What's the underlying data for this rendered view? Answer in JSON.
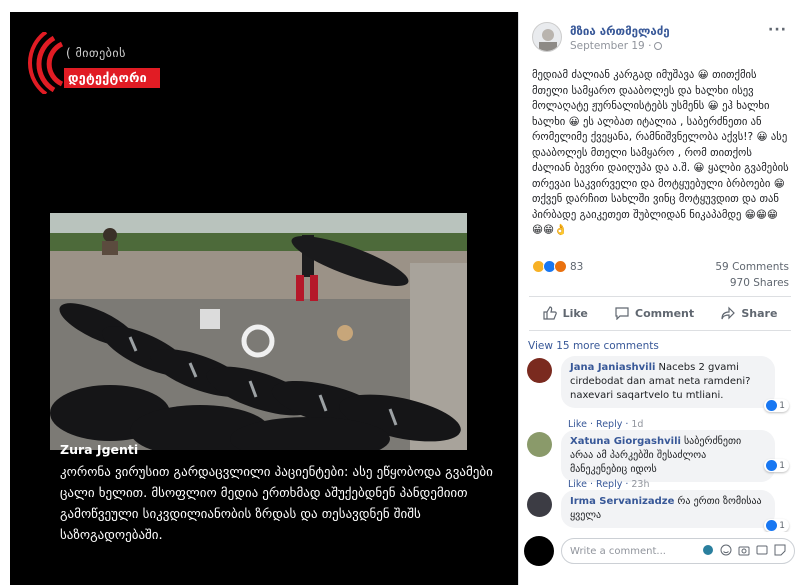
{
  "logo": {
    "line1": "( მითების",
    "line2": "დეტექტორი"
  },
  "caption": {
    "author": "Zura Jgenti",
    "text": "კორონა ვირუსით გარდაცვლილი პაციენტები: ასე ეწყობოდა გვამები ცალი ხელით. მსოფლიო მედია ერთხმად აშუქებდნენ პანდემიით გამოწვეული სიკვდილიანობის ზრდას და თესავდნენ შიშს საზოგადოებაში."
  },
  "post": {
    "name": "მზია ართმელაძე",
    "date": "September 19 ·",
    "more": "···",
    "body": "მედიამ ძალიან კარგად იმუშავა 😀 თითქმის მთელი სამყარო დააბოლეს და ხალხი ისევ მოლაღატე ჟურნალისტებს უსმენს 😀 ეჰ ხალხი ხალხი 😀 ეს ალბათ იტალია , საბერძნეთი ან რომელიმე ქვეყანა, რამნიშვნელობა აქვს!? 😀 ასე დააბოლეს მთელი სამყარო , რომ თითქოს ძალიან ბევრი დაიღუპა და ა.შ. 😀 ყალბი გვამების თრევაი საკვირველი და მოტყუებული ბრბოები 😁 თქვენ დარჩით სახლში ვინც მოტყუვდით და თან პირბადე გაიკეთეთ შუბლიდან ნიკაპამდე 😁😁😁 😁😁👌",
    "reactions_count": "83",
    "comments_count": "59 Comments",
    "shares_count": "970 Shares",
    "actions": {
      "like": "Like",
      "comment": "Comment",
      "share": "Share"
    },
    "view_more": "View 15 more comments"
  },
  "comments": [
    {
      "name": "Jana Janiashvili",
      "text": "Nacebs 2 gvami cirdebodat dan amat neta ramdeni?naxevari saqartvelo tu mtliani.",
      "like": "Like",
      "reply": "Reply",
      "time": "1d",
      "likes": "1"
    },
    {
      "name": "Xatuna Giorgashvili",
      "text": "საბერძნეთი არაა ამ პარკებში შესაძლოა მანეკენებიც იდოს",
      "like": "Like",
      "reply": "Reply",
      "time": "23h",
      "likes": "1"
    },
    {
      "name": "Irma Servanizadze",
      "text": "რა ერთი ზომისაა ყველა",
      "likes": "1"
    }
  ],
  "composer": {
    "placeholder": "Write a comment..."
  }
}
